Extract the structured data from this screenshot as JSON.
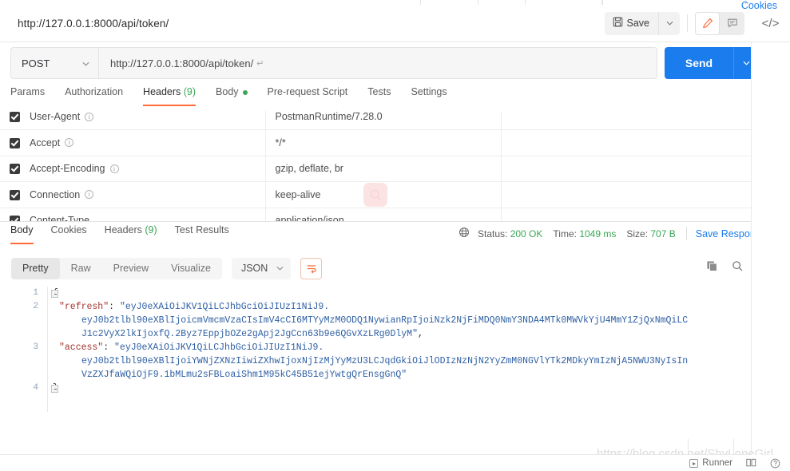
{
  "request": {
    "title": "http://127.0.0.1:8000/api/token/",
    "save_label": "Save",
    "method": "POST",
    "url": "http://127.0.0.1:8000/api/token/",
    "url_cr": "↵",
    "send_label": "Send",
    "cookies_label": "Cookies",
    "tabs": [
      {
        "label": "Params",
        "count": "",
        "active": false,
        "dot": false
      },
      {
        "label": "Authorization",
        "count": "",
        "active": false,
        "dot": false
      },
      {
        "label": "Headers",
        "count": "(9)",
        "active": true,
        "dot": false
      },
      {
        "label": "Body",
        "count": "",
        "active": false,
        "dot": true
      },
      {
        "label": "Pre-request Script",
        "count": "",
        "active": false,
        "dot": false
      },
      {
        "label": "Tests",
        "count": "",
        "active": false,
        "dot": false
      },
      {
        "label": "Settings",
        "count": "",
        "active": false,
        "dot": false
      }
    ]
  },
  "headers_table": {
    "rows": [
      {
        "checked": true,
        "key": "User-Agent",
        "info": true,
        "value": "PostmanRuntime/7.28.0",
        "description": ""
      },
      {
        "checked": true,
        "key": "Accept",
        "info": true,
        "value": "*/*",
        "description": ""
      },
      {
        "checked": true,
        "key": "Accept-Encoding",
        "info": true,
        "value": "gzip, deflate, br",
        "description": ""
      },
      {
        "checked": true,
        "key": "Connection",
        "info": true,
        "value": "keep-alive",
        "description": ""
      },
      {
        "checked": true,
        "key": "Content-Type",
        "info": false,
        "value": "application/json",
        "description": ""
      }
    ]
  },
  "response": {
    "tabs": [
      {
        "label": "Body",
        "count": "",
        "active": true
      },
      {
        "label": "Cookies",
        "count": "",
        "active": false
      },
      {
        "label": "Headers",
        "count": "(9)",
        "active": false
      },
      {
        "label": "Test Results",
        "count": "",
        "active": false
      }
    ],
    "status_label": "Status:",
    "status_value": "200 OK",
    "time_label": "Time:",
    "time_value": "1049 ms",
    "size_label": "Size:",
    "size_value": "707 B",
    "save_response_label": "Save Response",
    "view_modes": [
      {
        "label": "Pretty",
        "active": true
      },
      {
        "label": "Raw",
        "active": false
      },
      {
        "label": "Preview",
        "active": false
      },
      {
        "label": "Visualize",
        "active": false
      }
    ],
    "format": "JSON"
  },
  "code": {
    "lines": [
      {
        "n": "1",
        "fold": true,
        "segments": [
          {
            "t": "{",
            "c": "punct"
          }
        ]
      },
      {
        "n": "2",
        "fold": false,
        "indent": 0,
        "segments": [
          {
            "t": "\"refresh\"",
            "c": "key"
          },
          {
            "t": ": ",
            "c": "punct"
          },
          {
            "t": "\"eyJ0eXAiOiJKV1QiLCJhbGciOiJIUzI1NiJ9.",
            "c": "str"
          }
        ]
      },
      {
        "n": "",
        "fold": false,
        "indent": 1,
        "segments": [
          {
            "t": "eyJ0b2tlbl90eXBlIjoicmVmcmVzaCIsImV4cCI6MTYyMzM0ODQ1NywianRpIjoiNzk2NjFiMDQ0NmY3NDA4MTk0MWVkYjU4MmY1ZjQxNmQiLC",
            "c": "str"
          }
        ]
      },
      {
        "n": "",
        "fold": false,
        "indent": 1,
        "segments": [
          {
            "t": "J1c2VyX2lkIjoxfQ.2Byz7EppjbOZe2gApj2JgCcn63b9e6QGvXzLRg0DlyM\"",
            "c": "str"
          },
          {
            "t": ",",
            "c": "punct"
          }
        ]
      },
      {
        "n": "3",
        "fold": false,
        "indent": 0,
        "segments": [
          {
            "t": "\"access\"",
            "c": "key"
          },
          {
            "t": ": ",
            "c": "punct"
          },
          {
            "t": "\"eyJ0eXAiOiJKV1QiLCJhbGciOiJIUzI1NiJ9.",
            "c": "str"
          }
        ]
      },
      {
        "n": "",
        "fold": false,
        "indent": 1,
        "segments": [
          {
            "t": "eyJ0b2tlbl90eXBlIjoiYWNjZXNzIiwiZXhwIjoxNjIzMjYyMzU3LCJqdGkiOiJlODIzNzNjN2YyZmM0NGVlYTk2MDkyYmIzNjA5NWU3NyIsIn",
            "c": "str"
          }
        ]
      },
      {
        "n": "",
        "fold": false,
        "indent": 1,
        "segments": [
          {
            "t": "VzZXJfaWQiOjF9.1bMLmu2sFBLoaiShm1M95kC45B51ejYwtgQrEnsgGnQ\"",
            "c": "str"
          }
        ]
      },
      {
        "n": "4",
        "fold": true,
        "segments": [
          {
            "t": "}",
            "c": "punct"
          }
        ]
      }
    ]
  },
  "statusbar": {
    "runner_label": "Runner",
    "watermark": "https://blog.csdn.net/ShyLoneGirl"
  },
  "colors": {
    "accent_orange": "#ff6c37",
    "send_blue": "#1a7ced",
    "link_blue": "#1a7ced",
    "status_green": "#3aa755",
    "json_string": "#2e5fa3",
    "json_key": "#a3352e"
  }
}
